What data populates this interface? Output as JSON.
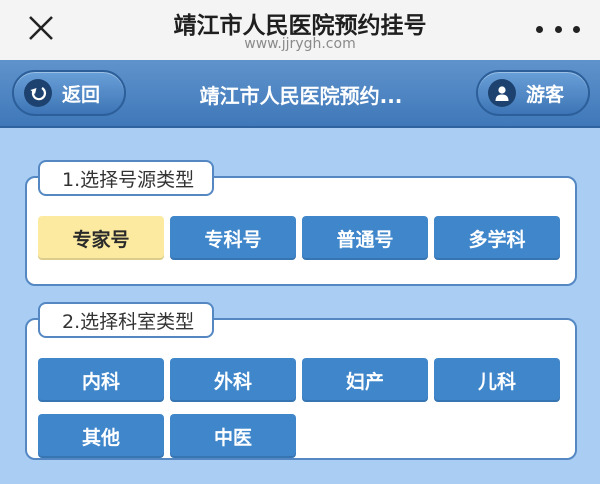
{
  "window": {
    "title": "靖江市人民医院预约挂号",
    "url": "www.jjrygh.com"
  },
  "header": {
    "back_label": "返回",
    "title": "靖江市人民医院预约...",
    "guest_label": "游客"
  },
  "source_section": {
    "title": "1.选择号源类型",
    "options": [
      {
        "label": "专家号",
        "selected": true
      },
      {
        "label": "专科号",
        "selected": false
      },
      {
        "label": "普通号",
        "selected": false
      },
      {
        "label": "多学科",
        "selected": false
      }
    ]
  },
  "dept_section": {
    "title": "2.选择科室类型",
    "options": [
      {
        "label": "内科"
      },
      {
        "label": "外科"
      },
      {
        "label": "妇产"
      },
      {
        "label": "儿科"
      },
      {
        "label": "其他"
      },
      {
        "label": "中医"
      }
    ]
  },
  "colors": {
    "button_blue": "#3f86cb",
    "selected_yellow": "#fbeaa0",
    "header_blue": "#4a80c0",
    "page_background": "#a9cdf3"
  }
}
